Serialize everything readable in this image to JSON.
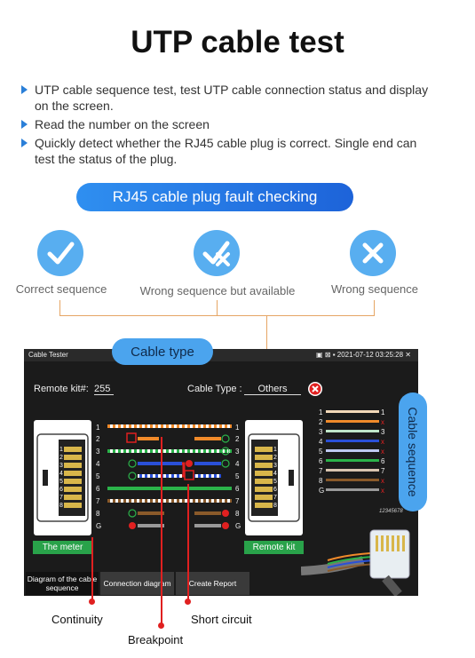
{
  "title": "UTP cable test",
  "bullets": [
    "UTP cable sequence test, test UTP cable connection status and display on the screen.",
    "Read the number on the screen",
    "Quickly detect whether the RJ45 cable plug is correct. Single end can test the status of the plug."
  ],
  "fault_banner": "RJ45 cable plug fault checking",
  "status_items": [
    {
      "label": "Correct sequence",
      "icon": "check-icon"
    },
    {
      "label": "Wrong sequence but available",
      "icon": "check-cross-icon"
    },
    {
      "label": "Wrong sequence",
      "icon": "cross-icon"
    }
  ],
  "callouts": {
    "cable_type": "Cable type",
    "cable_sequence": "Cable sequence"
  },
  "screen": {
    "app_title": "Cable Tester",
    "datetime": "2021-07-12 03:25:28",
    "remote_kit_label": "Remote kit#:",
    "remote_kit_value": "255",
    "cable_type_label": "Cable Type :",
    "cable_type_value": "Others",
    "left_label": "The meter",
    "right_label": "Remote kit",
    "pin_labels": [
      "1",
      "2",
      "3",
      "4",
      "5",
      "6",
      "7",
      "8",
      "G"
    ],
    "sequence_left": [
      "1",
      "2",
      "3",
      "4",
      "5",
      "6",
      "7",
      "8",
      "G"
    ],
    "sequence_right": [
      "1",
      "x",
      "3",
      "x",
      "x",
      "6",
      "7",
      "x",
      "x"
    ],
    "serial": "12345678",
    "tabs": [
      {
        "label": "Diagram of the cable sequence",
        "active": true
      },
      {
        "label": "Connection diagram",
        "active": false
      },
      {
        "label": "Create Report",
        "active": false
      }
    ]
  },
  "annotations": {
    "continuity": "Continuity",
    "breakpoint": "Breakpoint",
    "short_circuit": "Short circuit"
  },
  "colors": {
    "accent": "#2f8ff0",
    "ok": "#29a24a",
    "error": "#e02020",
    "orange_line": "#e6a564"
  }
}
